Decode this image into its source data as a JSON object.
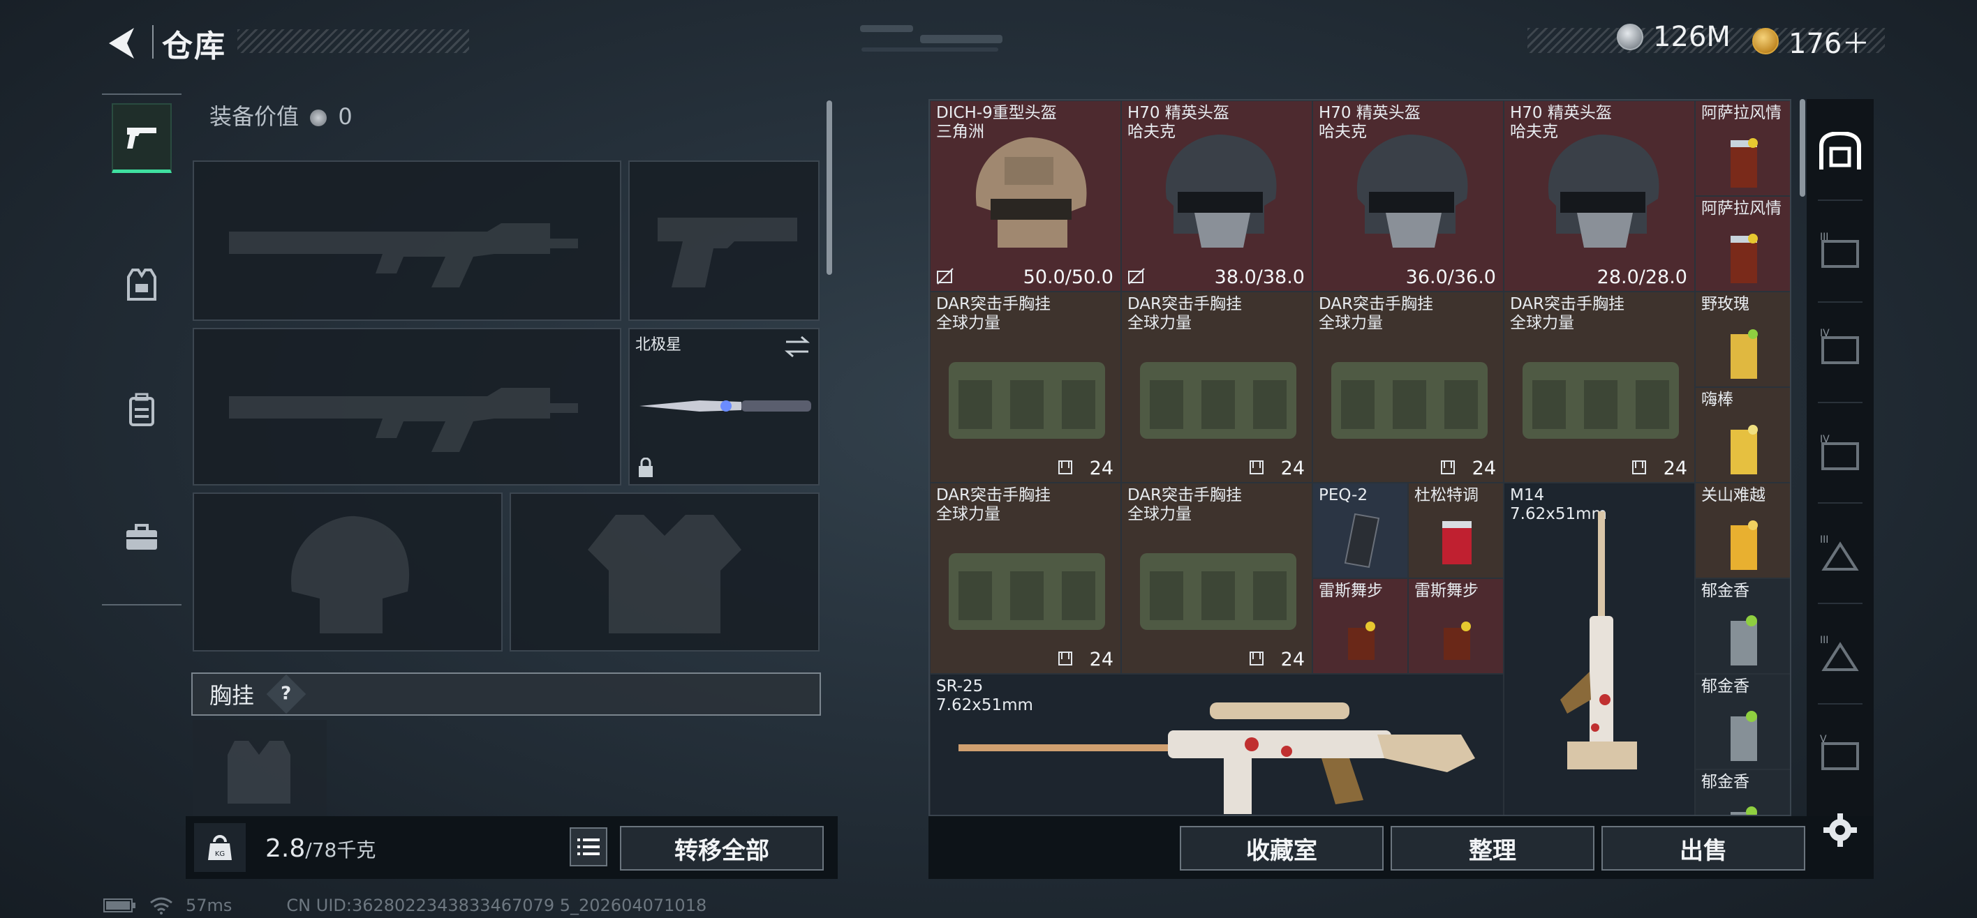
{
  "header": {
    "title": "仓库"
  },
  "currency": [
    {
      "name": "silver-coin-icon",
      "amount": "126M",
      "color": "#c0c6cc"
    },
    {
      "name": "gold-coin-icon",
      "amount": "176＋",
      "color": "#d9a53a"
    }
  ],
  "nav": [
    {
      "icon": "pistol-icon",
      "active": true
    },
    {
      "icon": "armor-vest-icon",
      "active": false
    },
    {
      "icon": "backpack-icon",
      "active": false
    },
    {
      "icon": "toolbox-icon",
      "active": false
    }
  ],
  "loadout": {
    "value_label": "装备价值",
    "value": "0",
    "melee_name": "北极星",
    "chest_label": "胸挂",
    "help_mark": "?"
  },
  "footer": {
    "weight_current": "2.8",
    "weight_max": "/78千克",
    "transfer_all": "转移全部",
    "buttons": [
      "收藏室",
      "整理",
      "出售"
    ]
  },
  "inventory": [
    {
      "name": "DICH-9重型头盔\n三角洲",
      "value": "50.0/50.0",
      "rarity": "red"
    },
    {
      "name": "H70 精英头盔\n哈夫克",
      "value": "38.0/38.0",
      "rarity": "red"
    },
    {
      "name": "H70 精英头盔\n哈夫克",
      "value": "36.0/36.0",
      "rarity": "red"
    },
    {
      "name": "H70 精英头盔\n哈夫克",
      "value": "28.0/28.0",
      "rarity": "red"
    },
    {
      "name": "阿萨拉风情",
      "value": "",
      "rarity": "red"
    },
    {
      "name": "阿萨拉风情",
      "value": "",
      "rarity": "red"
    },
    {
      "name": "DAR突击手胸挂\n全球力量",
      "value": "24",
      "rarity": "brown"
    },
    {
      "name": "DAR突击手胸挂\n全球力量",
      "value": "24",
      "rarity": "brown"
    },
    {
      "name": "DAR突击手胸挂\n全球力量",
      "value": "24",
      "rarity": "brown"
    },
    {
      "name": "DAR突击手胸挂\n全球力量",
      "value": "24",
      "rarity": "brown"
    },
    {
      "name": "野玫瑰",
      "value": "",
      "rarity": "brown"
    },
    {
      "name": "嗨棒",
      "value": "",
      "rarity": "brown"
    },
    {
      "name": "DAR突击手胸挂\n全球力量",
      "value": "24",
      "rarity": "brown"
    },
    {
      "name": "DAR突击手胸挂\n全球力量",
      "value": "24",
      "rarity": "brown"
    },
    {
      "name": "PEQ-2",
      "value": "",
      "rarity": "blue"
    },
    {
      "name": "杜松特调",
      "value": "",
      "rarity": "brown"
    },
    {
      "name": "雷斯舞步",
      "value": "",
      "rarity": "red"
    },
    {
      "name": "雷斯舞步",
      "value": "",
      "rarity": "red"
    },
    {
      "name": "M14\n7.62x51mm",
      "value": "",
      "rarity": "weapon"
    },
    {
      "name": "关山难越",
      "value": "",
      "rarity": "brown"
    },
    {
      "name": "郁金香",
      "value": "",
      "rarity": "dark"
    },
    {
      "name": "SR-25\n7.62x51mm",
      "value": "",
      "rarity": "weapon"
    },
    {
      "name": "郁金香",
      "value": "",
      "rarity": "dark"
    },
    {
      "name": "郁金香",
      "value": "",
      "rarity": "dark"
    }
  ],
  "rail": [
    {
      "icon": "safe-box-icon",
      "label": ""
    },
    {
      "icon": "case-tier-3-icon",
      "label": "III"
    },
    {
      "icon": "case-tier-4-icon",
      "label": "IV"
    },
    {
      "icon": "case-tier-4-icon",
      "label": "IV"
    },
    {
      "icon": "case-tier-3-icon",
      "label": "III"
    },
    {
      "icon": "case-tier-3-icon",
      "label": "III"
    },
    {
      "icon": "case-tier-5-icon",
      "label": "V"
    }
  ],
  "status": {
    "ping": "57ms",
    "uid": "CN UID:3628022343833467079 5_202604071018"
  }
}
